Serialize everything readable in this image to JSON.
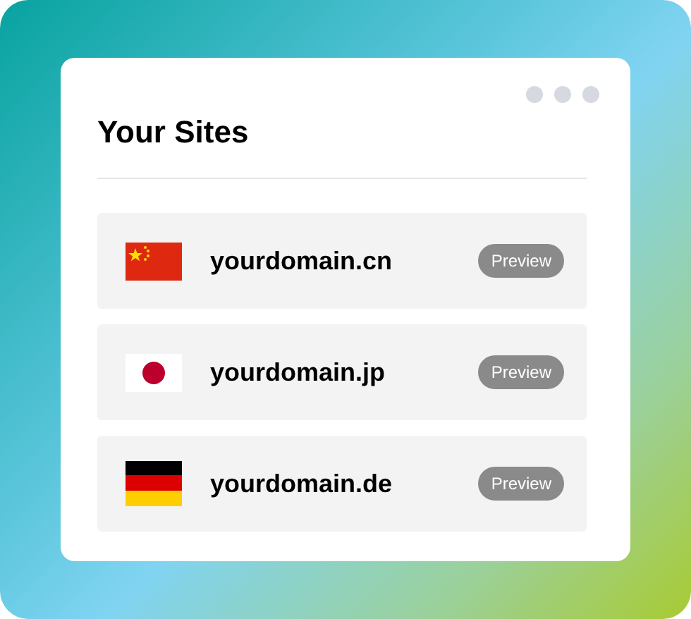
{
  "card": {
    "title": "Your Sites"
  },
  "sites": [
    {
      "kind": "cn",
      "domain": "yourdomain.cn",
      "button": "Preview"
    },
    {
      "kind": "jp",
      "domain": "yourdomain.jp",
      "button": "Preview"
    },
    {
      "kind": "de",
      "domain": "yourdomain.de",
      "button": "Preview"
    }
  ]
}
